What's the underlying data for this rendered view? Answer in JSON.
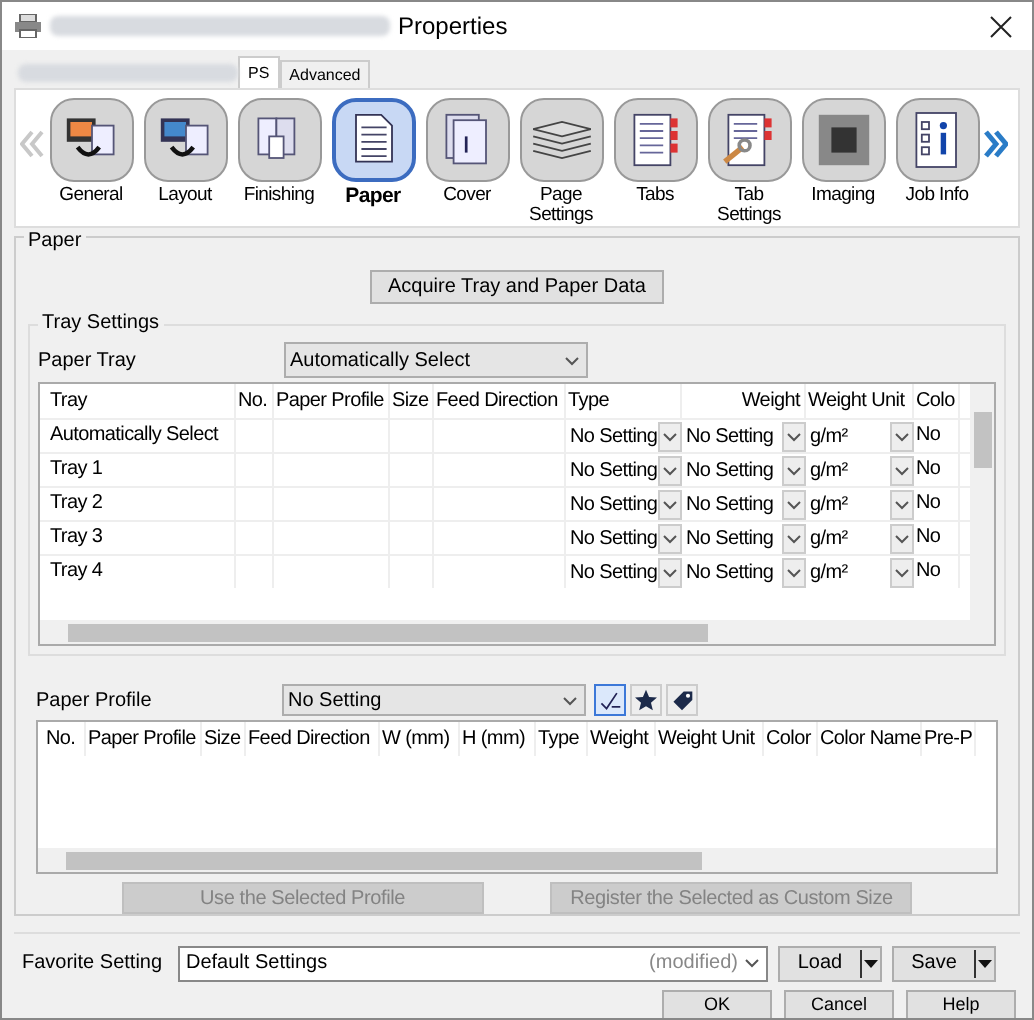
{
  "window": {
    "title": "Properties"
  },
  "top_tabs": [
    {
      "label": "PS",
      "selected": true
    },
    {
      "label": "Advanced",
      "selected": false
    }
  ],
  "categories": [
    {
      "label": "General",
      "selected": false
    },
    {
      "label": "Layout",
      "selected": false
    },
    {
      "label": "Finishing",
      "selected": false
    },
    {
      "label": "Paper",
      "selected": true
    },
    {
      "label": "Cover",
      "selected": false
    },
    {
      "label": "Page Settings",
      "selected": false
    },
    {
      "label": "Tabs",
      "selected": false
    },
    {
      "label": "Tab Settings",
      "selected": false
    },
    {
      "label": "Imaging",
      "selected": false
    },
    {
      "label": "Job Info",
      "selected": false
    }
  ],
  "paper": {
    "title": "Paper",
    "acquire_button": "Acquire Tray and Paper Data",
    "tray_settings": {
      "title": "Tray Settings",
      "paper_tray": {
        "label": "Paper Tray",
        "value": "Automatically Select"
      },
      "table": {
        "columns": [
          "Tray",
          "No.",
          "Paper Profile",
          "Size",
          "Feed Direction",
          "Type",
          "Weight",
          "Weight Unit",
          "Colo"
        ],
        "rows": [
          {
            "tray": "Automatically Select",
            "type": "No Setting",
            "weight": "No Setting",
            "weight_unit": "g/m²",
            "column_9": "No"
          },
          {
            "tray": "Tray 1",
            "type": "No Setting",
            "weight": "No Setting",
            "weight_unit": "g/m²",
            "column_9": "No"
          },
          {
            "tray": "Tray 2",
            "type": "No Setting",
            "weight": "No Setting",
            "weight_unit": "g/m²",
            "column_9": "No"
          },
          {
            "tray": "Tray 3",
            "type": "No Setting",
            "weight": "No Setting",
            "weight_unit": "g/m²",
            "column_9": "No"
          },
          {
            "tray": "Tray 4",
            "type": "No Setting",
            "weight": "No Setting",
            "weight_unit": "g/m²",
            "column_9": "No"
          }
        ]
      }
    },
    "paper_profile": {
      "label": "Paper Profile",
      "value": "No Setting"
    },
    "profile_table": {
      "columns": [
        "No.",
        "Paper Profile",
        "Size",
        "Feed Direction",
        "W (mm)",
        "H (mm)",
        "Type",
        "Weight",
        "Weight Unit",
        "Color",
        "Color Name",
        "Pre-P"
      ]
    },
    "actions": [
      {
        "label": "Use the Selected Profile",
        "disabled": true
      },
      {
        "label": "Register the Selected as Custom Size",
        "disabled": true
      }
    ]
  },
  "favorite": {
    "label": "Favorite Setting",
    "value": "Default Settings",
    "status": "(modified)",
    "load": "Load",
    "save": "Save"
  },
  "buttons": [
    "OK",
    "Cancel",
    "Help"
  ]
}
